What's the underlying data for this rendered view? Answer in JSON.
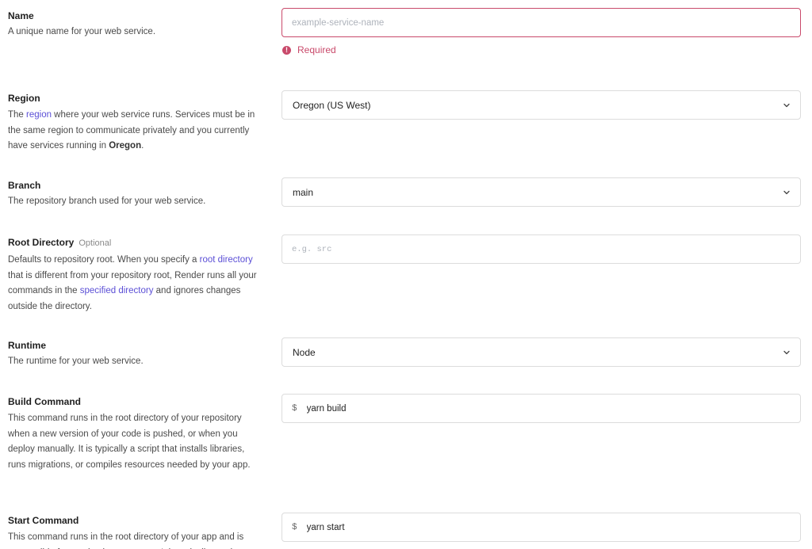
{
  "name": {
    "label": "Name",
    "description": "A unique name for your web service.",
    "placeholder": "example-service-name",
    "value": "",
    "error": "Required"
  },
  "region": {
    "label": "Region",
    "desc_pre": "The ",
    "desc_link": "region",
    "desc_mid": " where your web service runs. Services must be in the same region to communicate privately and you currently have services running in ",
    "desc_bold": "Oregon",
    "desc_post": ".",
    "selected": "Oregon (US West)"
  },
  "branch": {
    "label": "Branch",
    "description": "The repository branch used for your web service.",
    "selected": "main"
  },
  "root_directory": {
    "label": "Root Directory",
    "optional": "Optional",
    "desc_pre": "Defaults to repository root. When you specify a ",
    "desc_link1": "root directory",
    "desc_mid": " that is different from your repository root, Render runs all your commands in the ",
    "desc_link2": "specified directory",
    "desc_post": " and ignores changes outside the directory.",
    "placeholder": "e.g. src",
    "value": ""
  },
  "runtime": {
    "label": "Runtime",
    "description": "The runtime for your web service.",
    "selected": "Node"
  },
  "build_command": {
    "label": "Build Command",
    "description": "This command runs in the root directory of your repository when a new version of your code is pushed, or when you deploy manually. It is typically a script that installs libraries, runs migrations, or compiles resources needed by your app.",
    "prefix": "$",
    "value": "yarn build"
  },
  "start_command": {
    "label": "Start Command",
    "description": "This command runs in the root directory of your app and is responsible for starting its processes. It is typically used",
    "prefix": "$",
    "value": "yarn start"
  },
  "colors": {
    "error": "#c94a6b",
    "link": "#5b4fd6",
    "border": "#dcdcdc"
  },
  "icons": {
    "error": "exclamation-circle-icon",
    "select": "chevron-down-icon"
  }
}
